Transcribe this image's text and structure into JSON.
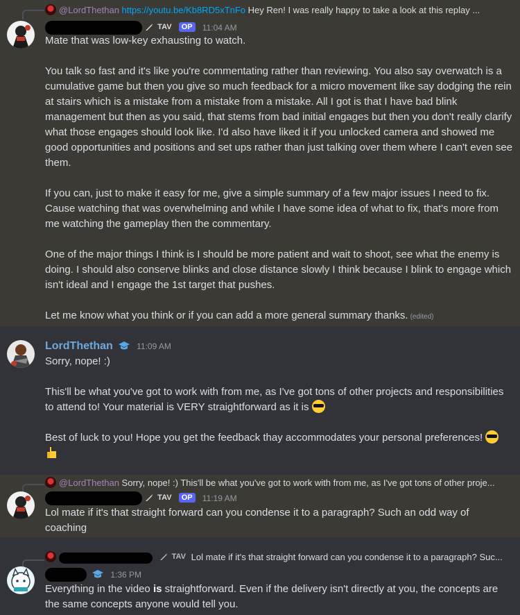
{
  "messages": [
    {
      "reply_ref": {
        "author": "@LordThethan",
        "link": "https://youtu.be/Kb8RD5xTnFo",
        "snippet": "Hey Ren! I was really happy to take a look at this replay ..."
      },
      "author_tag": "TAV",
      "op_badge": "OP",
      "timestamp": "11:04 AM",
      "paragraphs": [
        "Mate that was low-key exhausting to watch.",
        "You talk so fast and it's like you're commentating rather than reviewing. You also say overwatch is a cumulative game but then you give so much feedback for a micro movement like say dodging the rein at stairs which is a mistake from a mistake from a mistake. All I got is that I have bad blink management but then as you said, that stems from bad initial engages but then you don't really clarify what those engages should look like. I'd also have liked it if you unlocked camera and showed me good opportunities and positions and set ups rather than just talking over them where I can't even see them.",
        "If you can, just to make it easy for me, give a simple summary of a few major issues I need to fix. Cause watching that was overwhelming and while I have some idea of what to fix, that's more from me watching the gameplay then the commentary.",
        "One of the major things I think is I should be more patient and wait to shoot, see what the enemy is doing. I should also conserve blinks and close distance slowly I think because I blink to engage which isn't ideal and I engage the 1st target that pushes.",
        "Let me know what you think or if you can add a more general summary thanks."
      ],
      "edited_label": "(edited)"
    },
    {
      "author": "LordThethan",
      "timestamp": "11:09 AM",
      "lines": {
        "l1": "Sorry, nope! :)",
        "l2": "This'll be what you've got to work with from me, as I've got tons of other projects and responsibilities to attend to! Your material is VERY straightforward as it is",
        "l3": "Best of luck to you! Hope you get the feedback thay accommodates your personal preferences!"
      }
    },
    {
      "reply_ref": {
        "author": "@LordThethan",
        "snippet": "Sorry, nope! :)  This'll be what you've got to work with from me, as I've got tons of other proje..."
      },
      "author_tag": "TAV",
      "op_badge": "OP",
      "timestamp": "11:19 AM",
      "text": "Lol mate if it's that straight forward can you condense it to a paragraph? Such an odd way of coaching"
    },
    {
      "reply_ref": {
        "author_tag": "TAV",
        "snippet": "Lol mate if it's that straight forward can you condense it to a paragraph? Suc..."
      },
      "timestamp": "1:36 PM",
      "text_pre": "Everything in the video ",
      "text_bold": "is",
      "text_post": " straightforward. Even if the delivery isn't directly at you, the concepts are the same concepts anyone would tell you."
    }
  ],
  "icons": [
    "sword-icon",
    "graduation-cap-icon",
    "sunglasses-emoji",
    "thumbs-up-emoji"
  ]
}
